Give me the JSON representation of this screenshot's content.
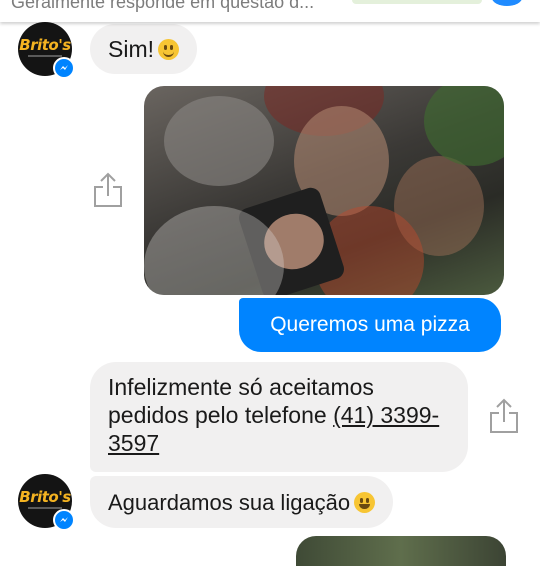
{
  "header": {
    "subtitle": "Geralmente responde em questão d..."
  },
  "page": {
    "avatar_label": "Brito's"
  },
  "messages": [
    {
      "from": "page",
      "text": "Sim!",
      "emoji": "slightly-smiling-face"
    },
    {
      "from": "user",
      "type": "photo",
      "description_icon": "photo-attachment"
    },
    {
      "from": "user",
      "text": "Queremos uma pizza"
    },
    {
      "from": "page",
      "text": "Infelizmente só aceitamos pedidos pelo telefone",
      "phone": "(41) 3399-3597"
    },
    {
      "from": "page",
      "text": "Aguardamos sua ligação",
      "emoji": "grinning-face"
    }
  ],
  "colors": {
    "outgoing_bubble": "#0084ff",
    "incoming_bubble": "#f1f0f0",
    "avatar_logo": "#f4b321"
  }
}
